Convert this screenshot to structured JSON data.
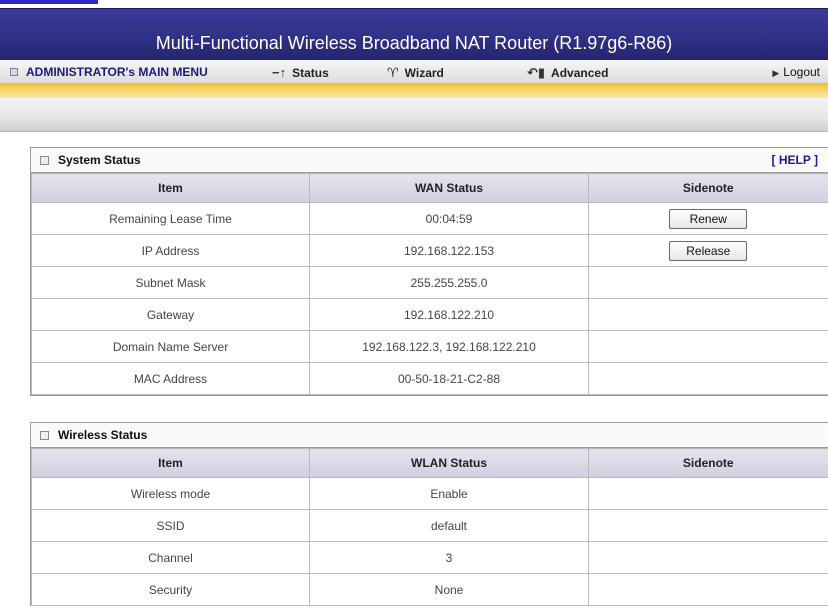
{
  "header": {
    "title": "Multi-Functional Wireless Broadband NAT Router (R1.97g6-R86)"
  },
  "menu": {
    "admin": "ADMINISTRATOR's MAIN MENU",
    "status": "Status",
    "wizard": "Wizard",
    "advanced": "Advanced",
    "logout": "Logout"
  },
  "system_status": {
    "title": "System Status",
    "help": "[ HELP ]",
    "columns": [
      "Item",
      "WAN Status",
      "Sidenote"
    ],
    "rows": [
      {
        "item": "Remaining Lease Time",
        "value": "00:04:59",
        "button": "Renew"
      },
      {
        "item": "IP Address",
        "value": "192.168.122.153",
        "button": "Release"
      },
      {
        "item": "Subnet Mask",
        "value": "255.255.255.0"
      },
      {
        "item": "Gateway",
        "value": "192.168.122.210"
      },
      {
        "item": "Domain Name Server",
        "value": "192.168.122.3, 192.168.122.210"
      },
      {
        "item": "MAC Address",
        "value": "00-50-18-21-C2-88"
      }
    ]
  },
  "wireless_status": {
    "title": "Wireless Status",
    "columns": [
      "Item",
      "WLAN Status",
      "Sidenote"
    ],
    "rows": [
      {
        "item": "Wireless mode",
        "value": "Enable"
      },
      {
        "item": "SSID",
        "value": "default"
      },
      {
        "item": "Channel",
        "value": "3"
      },
      {
        "item": "Security",
        "value": "None"
      }
    ]
  }
}
